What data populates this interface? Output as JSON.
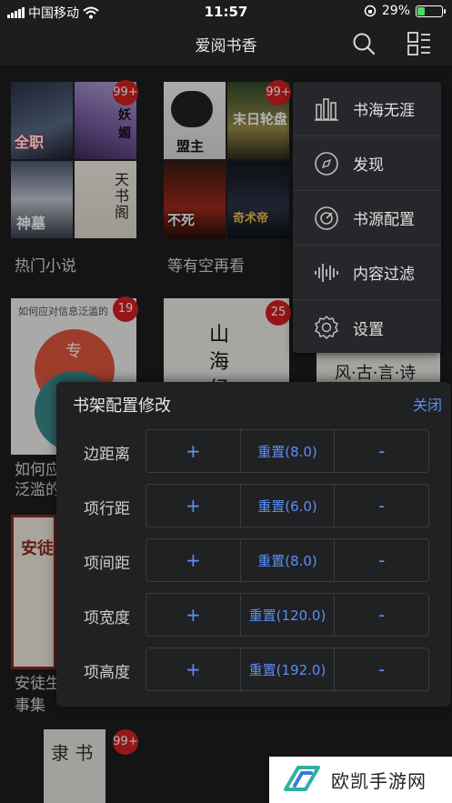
{
  "status": {
    "carrier": "中国移动",
    "time": "11:57",
    "battery": "29%",
    "battery_level": 0.29
  },
  "nav": {
    "title": "爱阅书香"
  },
  "books": [
    {
      "title": "热门小说",
      "badge": "99+"
    },
    {
      "title": "等有空再看",
      "badge": "99+"
    },
    {
      "title": "如何应对信息泛滥的时代",
      "title_line1": "如何应",
      "title_line2": "泛滥的",
      "badge": "19",
      "cover_caption": "如何应对信息泛滥的"
    },
    {
      "title": "山海经",
      "badge": "25",
      "cover_text": "山\n海\n经"
    },
    {
      "title": "安徒生童话故事集",
      "title_line1": "安徒生",
      "title_line2": "事集",
      "cover_text": "安徒"
    },
    {
      "title": "",
      "badge": "99+"
    }
  ],
  "menu": {
    "items": [
      {
        "label": "书海无涯",
        "icon": "bookshelf-icon"
      },
      {
        "label": "发现",
        "icon": "compass-icon"
      },
      {
        "label": "书源配置",
        "icon": "source-config-icon"
      },
      {
        "label": "内容过滤",
        "icon": "waveform-icon"
      },
      {
        "label": "设置",
        "icon": "gear-icon"
      }
    ]
  },
  "config": {
    "title": "书架配置修改",
    "close": "关闭",
    "rows": [
      {
        "label": "边距离",
        "plus": "+",
        "reset": "重置(8.0)",
        "minus": "-"
      },
      {
        "label": "项行距",
        "plus": "+",
        "reset": "重置(6.0)",
        "minus": "-"
      },
      {
        "label": "项间距",
        "plus": "+",
        "reset": "重置(8.0)",
        "minus": "-"
      },
      {
        "label": "项宽度",
        "plus": "+",
        "reset": "重置(120.0)",
        "minus": "-"
      },
      {
        "label": "项高度",
        "plus": "+",
        "reset": "重置(192.0)",
        "minus": "-"
      }
    ]
  },
  "watermark": {
    "text": "欧凯手游网"
  },
  "colors": {
    "accent": "#5b8ff5",
    "badge": "#d62020",
    "background": "#1d1d1f"
  }
}
